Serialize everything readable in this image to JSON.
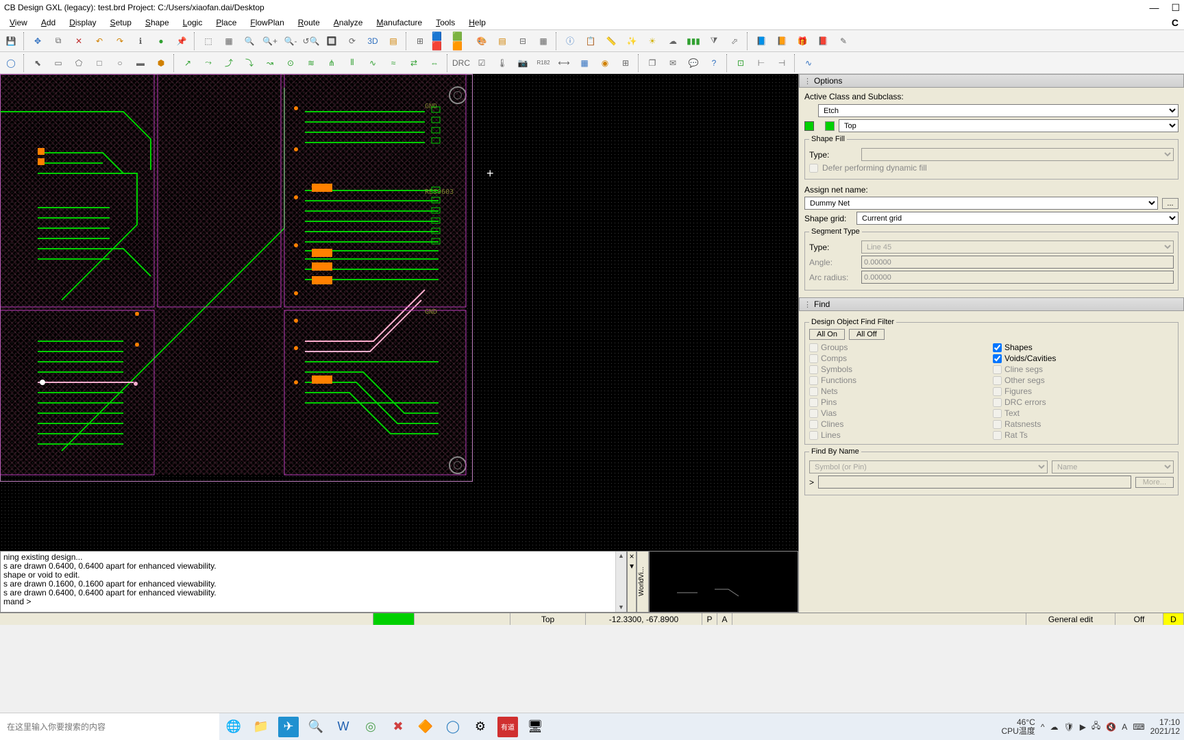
{
  "title": "CB Design GXL (legacy): test.brd  Project: C:/Users/xiaofan.dai/Desktop",
  "menu": [
    "View",
    "Add",
    "Display",
    "Setup",
    "Shape",
    "Logic",
    "Place",
    "FlowPlan",
    "Route",
    "Analyze",
    "Manufacture",
    "Tools",
    "Help"
  ],
  "right_brand": "C",
  "crosshair": "+",
  "canvas_labels": {
    "gnd1": "GND",
    "gnd2": "GND",
    "res": "RES0603"
  },
  "console_lines": [
    "ning existing design...",
    "s are drawn 0.6400, 0.6400 apart for enhanced viewability.",
    " shape or void to edit.",
    "s are drawn 0.1600, 0.1600 apart for enhanced viewability.",
    "s are drawn 0.6400, 0.6400 apart for enhanced viewability.",
    "mand >"
  ],
  "worldview_tab": "WorldVi...",
  "status": {
    "layer": "Top",
    "coords": "-12.3300, -67.8900",
    "p": "P",
    "a": "A",
    "mode": "General edit",
    "drc": "Off",
    "last": "D"
  },
  "options": {
    "header": "Options",
    "active_class_label": "Active Class and Subclass:",
    "class": "Etch",
    "subclass": "Top",
    "shape_fill": {
      "legend": "Shape Fill",
      "type_label": "Type:",
      "type": "",
      "defer": "Defer performing dynamic fill"
    },
    "assign_net_label": "Assign net name:",
    "assign_net": "Dummy Net",
    "browse": "...",
    "shape_grid_label": "Shape grid:",
    "shape_grid": "Current grid",
    "segment": {
      "legend": "Segment Type",
      "type_label": "Type:",
      "type": "Line 45",
      "angle_label": "Angle:",
      "angle": "0.00000",
      "arc_label": "Arc radius:",
      "arc": "0.00000"
    }
  },
  "find": {
    "header": "Find",
    "filter_legend": "Design Object Find Filter",
    "all_on": "All On",
    "all_off": "All Off",
    "items_left": [
      "Groups",
      "Comps",
      "Symbols",
      "Functions",
      "Nets",
      "Pins",
      "Vias",
      "Clines",
      "Lines"
    ],
    "items_right": [
      "Shapes",
      "Voids/Cavities",
      "Cline segs",
      "Other segs",
      "Figures",
      "DRC errors",
      "Text",
      "Ratsnests",
      "Rat Ts"
    ],
    "checked_right": [
      true,
      true,
      false,
      false,
      false,
      false,
      false,
      false,
      false
    ],
    "by_name_legend": "Find By Name",
    "by_name_type": "Symbol (or Pin)",
    "by_name_mode": "Name",
    "prompt": ">",
    "more": "More..."
  },
  "taskbar": {
    "search_placeholder": "在这里输入你要搜索的内容",
    "weather_temp": "46°C",
    "weather_label": "CPU温度",
    "time": "17:10",
    "date": "2021/12"
  }
}
